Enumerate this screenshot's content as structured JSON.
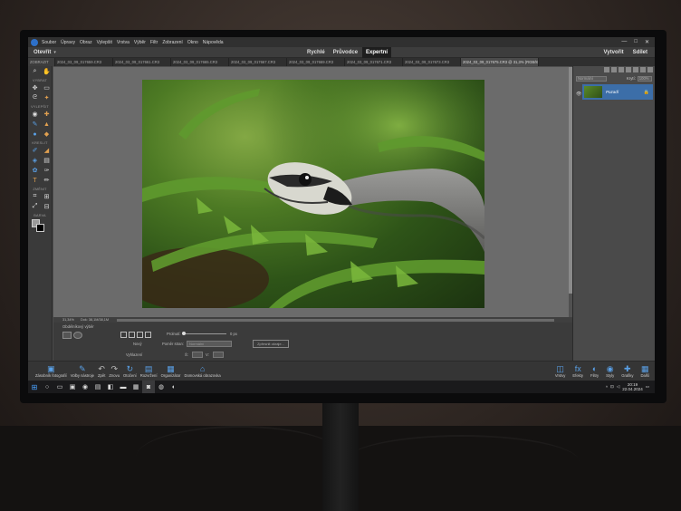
{
  "menubar": {
    "items": [
      "Soubor",
      "Úpravy",
      "Obraz",
      "Vylepšit",
      "Vrstva",
      "Výběr",
      "Filtr",
      "Zobrazení",
      "Okno",
      "Nápověda"
    ]
  },
  "window_controls": {
    "minimize": "—",
    "maximize": "□",
    "close": "✕"
  },
  "modebar": {
    "open_label": "Otevřít",
    "modes": [
      "Rychlé",
      "Průvodce",
      "Expertní"
    ],
    "active_mode": "Expertní",
    "create_label": "Vytvořit",
    "share_label": "Sdílet"
  },
  "tabs": [
    "2024_03_09_017659.CR3",
    "2024_03_09_017661.CR3",
    "2024_03_09_017665.CR3",
    "2024_03_09_017667.CR3",
    "2024_03_09_017669.CR3",
    "2024_03_09_017671.CR3",
    "2024_03_09_017673.CR3",
    "2024_03_09_017675.CR3 @ 31,3% (RGB/8)"
  ],
  "toolbar": {
    "sections": [
      "ZOBRAZIT",
      "VYBRAT",
      "VYLEPŠIT",
      "KRESLIT",
      "ZMĚNIT",
      "BARVA"
    ]
  },
  "status": {
    "zoom": "31,34%",
    "doc": "Dok: 38,1M/38,1M"
  },
  "options": {
    "title": "Obdélníkový výběr",
    "new_label": "Nový",
    "feather_label": "Vyhlazení",
    "feather_short": "Prolnutí:",
    "feather_value": "0 px",
    "aspect_label": "Poměr stran:",
    "aspect_value": "Normální",
    "w_label": "Š:",
    "h_label": "V:",
    "refine_label": "Zpřesnit okraje..."
  },
  "layers": {
    "blend_mode": "Normální",
    "opacity_label": "Krytí:",
    "opacity_value": "100%",
    "layer_name": "Pozadí"
  },
  "bottombar": {
    "left": [
      {
        "label": "Zásobník fotografií",
        "icon": "photo-bin-icon"
      },
      {
        "label": "Volby nástroje",
        "icon": "tool-options-icon"
      },
      {
        "label": "Zpět",
        "icon": "undo-icon"
      },
      {
        "label": "Znovu",
        "icon": "redo-icon"
      },
      {
        "label": "Otočení",
        "icon": "rotate-icon"
      },
      {
        "label": "Rozvržení",
        "icon": "layout-icon"
      },
      {
        "label": "Organizátor",
        "icon": "organizer-icon"
      },
      {
        "label": "Domovská obrazovka",
        "icon": "home-icon"
      }
    ],
    "right": [
      {
        "label": "Vrstvy",
        "icon": "layers-icon"
      },
      {
        "label": "Efekty",
        "icon": "fx-icon"
      },
      {
        "label": "Filtry",
        "icon": "filters-icon"
      },
      {
        "label": "Styly",
        "icon": "styles-icon"
      },
      {
        "label": "Grafiky",
        "icon": "graphics-icon"
      },
      {
        "label": "Další",
        "icon": "more-icon"
      }
    ]
  },
  "taskbar": {
    "time": "20:19",
    "date": "22.04.2024"
  },
  "colors": {
    "accent": "#3c6ea8",
    "app_bg": "#4d4d4d",
    "photo_green": "#4d7a24"
  }
}
